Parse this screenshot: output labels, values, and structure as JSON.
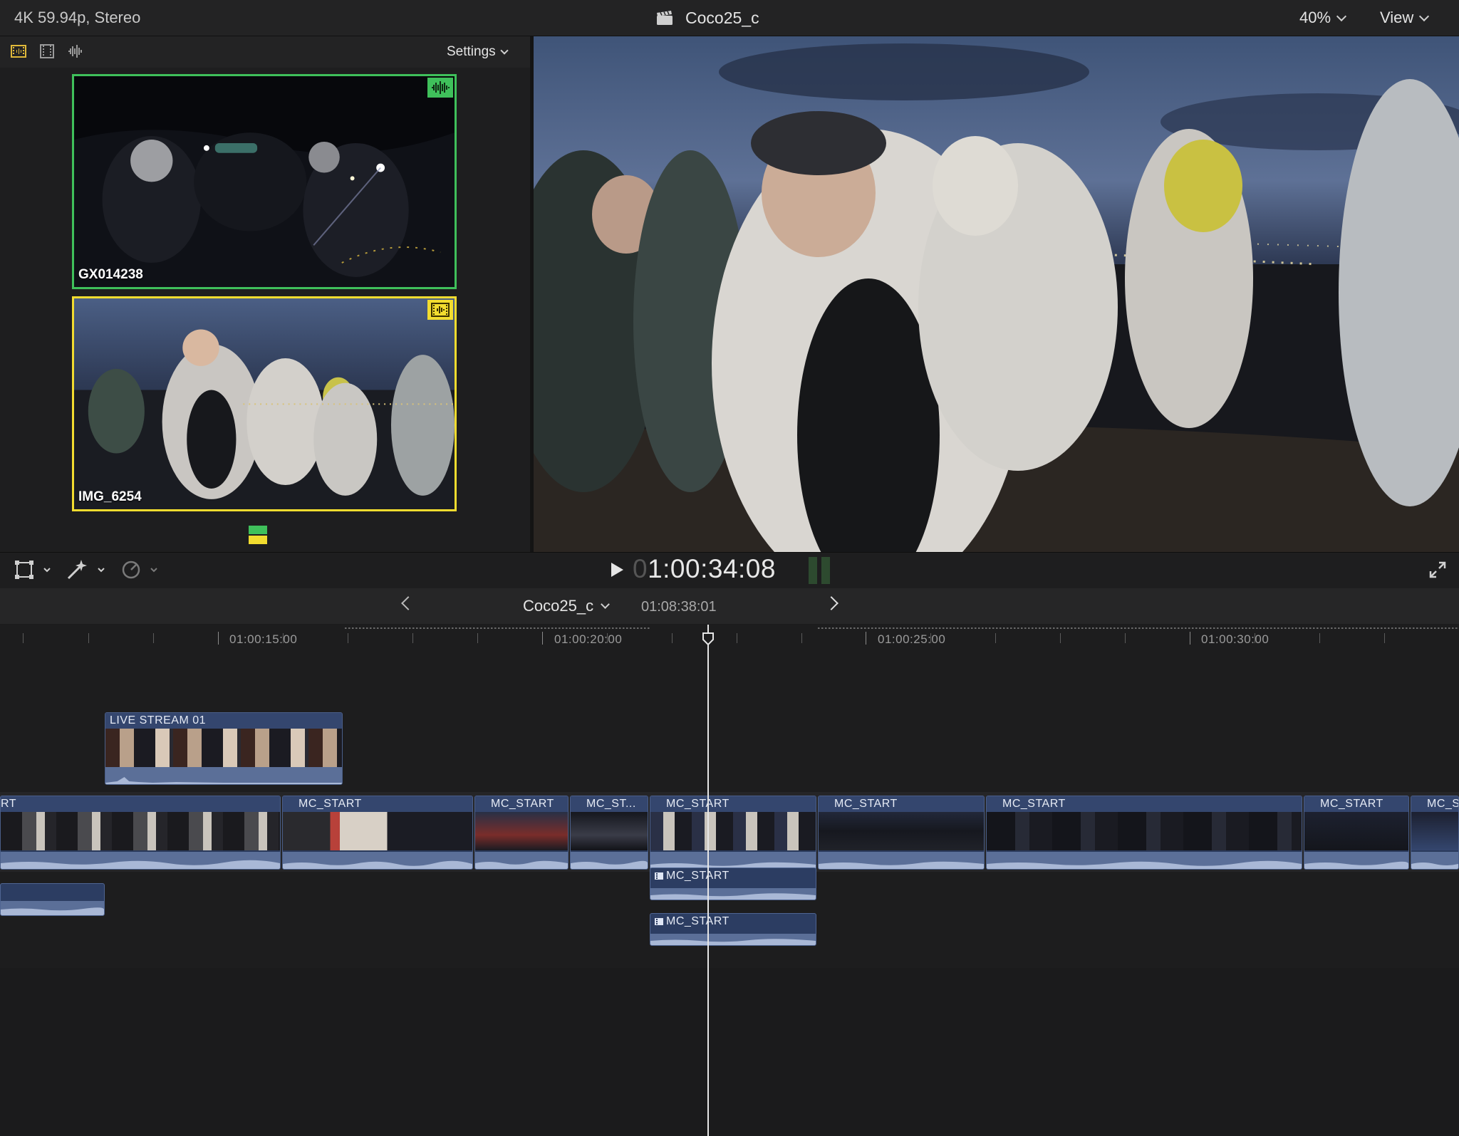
{
  "topbar": {
    "format": "4K 59.94p, Stereo",
    "title": "Coco25_c",
    "zoom": "40%",
    "view": "View"
  },
  "angle_viewer": {
    "settings": "Settings",
    "angles": [
      {
        "label": "GX014238",
        "type": "audio",
        "color": "#3fc05b"
      },
      {
        "label": "IMG_6254",
        "type": "video",
        "color": "#f2dc2f"
      }
    ]
  },
  "viewer": {
    "timecode_prefix": "0",
    "timecode": "1:00:34:08"
  },
  "timeline": {
    "project": "Coco25_c",
    "duration": "01:08:38:01",
    "ruler": [
      "01:00:15:00",
      "01:00:20:00",
      "01:00:25:00",
      "01:00:30:00"
    ],
    "connected_top": "LIVE STREAM 01",
    "primary_clips": [
      "RT",
      "MC_START",
      "MC_START",
      "MC_ST...",
      "MC_START",
      "MC_START",
      "MC_START",
      "MC_START",
      "MC_S"
    ],
    "connected_below": [
      "MC_START",
      "MC_START"
    ]
  },
  "colors": {
    "angle_active_video": "#f2dc2f",
    "angle_active_audio": "#3fc05b",
    "clip_blue": "#34466e"
  }
}
